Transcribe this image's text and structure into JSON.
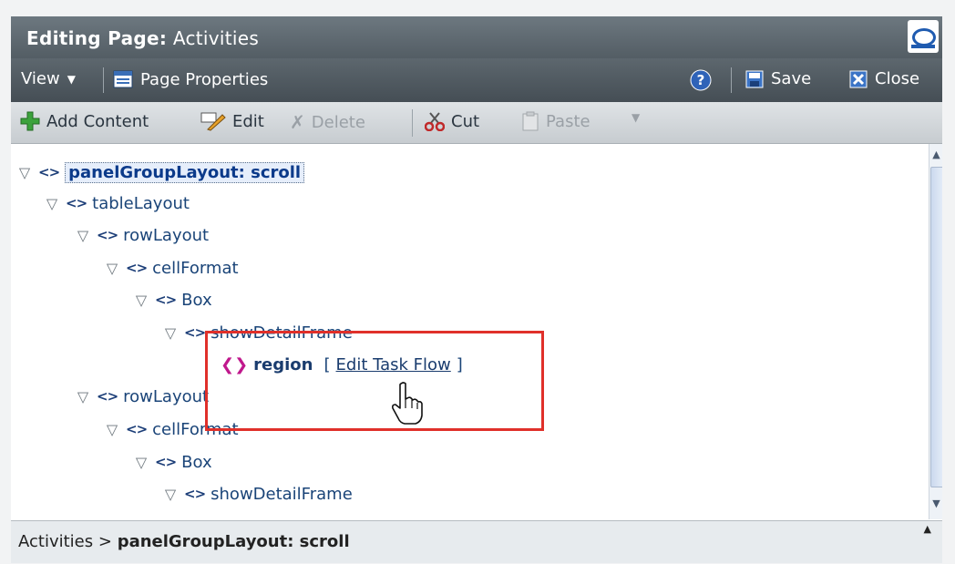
{
  "title": {
    "prefix": "Editing Page:",
    "name": "Activities"
  },
  "menubar": {
    "view": "View",
    "page_properties": "Page Properties",
    "save": "Save",
    "close": "Close"
  },
  "toolbar": {
    "add_content": "Add Content",
    "edit": "Edit",
    "delete": "Delete",
    "cut": "Cut",
    "paste": "Paste"
  },
  "tree": {
    "n0": "panelGroupLayout: scroll",
    "n1": "tableLayout",
    "n2": "rowLayout",
    "n3": "cellFormat",
    "n4": "Box",
    "n5": "showDetailFrame",
    "region": {
      "label": "region",
      "open": "[",
      "link": "Edit Task Flow",
      "close": "]"
    },
    "n7": "rowLayout",
    "n8": "cellFormat",
    "n9": "Box",
    "n10": "showDetailFrame"
  },
  "status": {
    "root": "Activities",
    "sep": ">",
    "current": "panelGroupLayout: scroll"
  },
  "colors": {
    "titlebar": "#5f6a71",
    "highlight_box": "#e0302a",
    "region_tag": "#c0188c"
  }
}
